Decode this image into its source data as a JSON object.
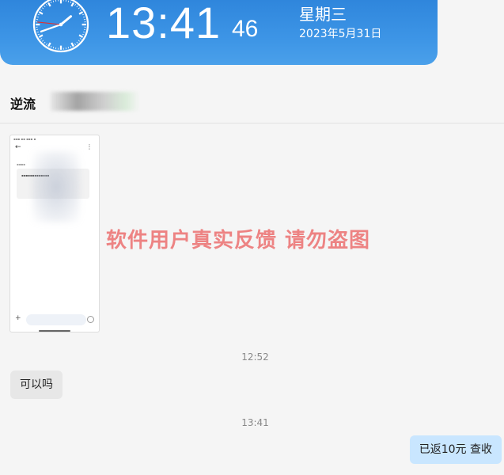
{
  "clock": {
    "time": "13:41",
    "seconds": "46",
    "weekday": "星期三",
    "date": "2023年5月31日",
    "hour": 13,
    "minute": 41,
    "second": 46
  },
  "chat": {
    "contact_name": "逆流",
    "messages": [
      {
        "type": "image",
        "sender": "contact"
      },
      {
        "type": "time",
        "text": "12:52"
      },
      {
        "type": "text",
        "sender": "contact",
        "text": "可以吗"
      },
      {
        "type": "time",
        "text": "13:41"
      },
      {
        "type": "text",
        "sender": "me",
        "text": "已返10元 查收"
      }
    ]
  },
  "watermark": "软件用户真实反馈  请勿盗图",
  "colors": {
    "banner": "#3d95e6",
    "outgoing_bubble": "#c9e6ff",
    "incoming_bubble": "#e7e7e7",
    "watermark": "#eb6e6e"
  }
}
